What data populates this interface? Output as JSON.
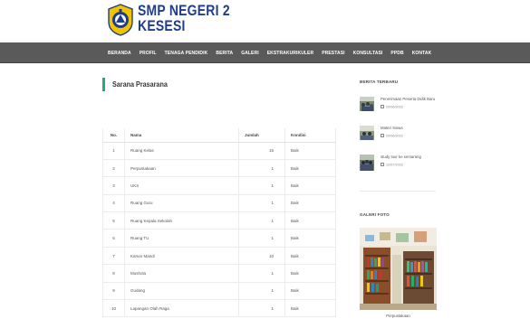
{
  "header": {
    "school_line1": "SMP NEGERI 2",
    "school_line2": "KESESI",
    "logo_icon": "school-emblem-icon"
  },
  "nav": {
    "items": [
      "BERANDA",
      "PROFIL",
      "TENAGA PENDIDIK",
      "BERITA",
      "GALERI",
      "EKSTRAKURIKULER",
      "PRESTASI",
      "KONSULTASI",
      "PPDB",
      "KONTAK"
    ]
  },
  "main": {
    "title": "Sarana Prasarana",
    "table": {
      "headers": [
        "No.",
        "Nama",
        "Jumlah",
        "Kondisi"
      ],
      "rows": [
        [
          "1",
          "Ruang Kelas",
          "15",
          "Baik"
        ],
        [
          "2",
          "Perpustakaan",
          "1",
          "Baik"
        ],
        [
          "3",
          "UKS",
          "1",
          "Baik"
        ],
        [
          "4",
          "Ruang Guru",
          "1",
          "Baik"
        ],
        [
          "5",
          "Ruang Kepala Sekolah",
          "1",
          "Baik"
        ],
        [
          "6",
          "Ruang TU",
          "1",
          "Baik"
        ],
        [
          "7",
          "Kamar Mandi",
          "10",
          "Baik"
        ],
        [
          "8",
          "Mushola",
          "1",
          "Baik"
        ],
        [
          "9",
          "Gudang",
          "1",
          "Baik"
        ],
        [
          "10",
          "Lapangan Olah Raga",
          "1",
          "Baik"
        ]
      ]
    }
  },
  "sidebar": {
    "news_title": "BERITA TERBARU",
    "news": [
      {
        "title": "Penerimaan Peserta Didik Baru",
        "date": "20/06/2022"
      },
      {
        "title": "Materi Siswa",
        "date": "20/06/2021"
      },
      {
        "title": "study tour ke semarang",
        "date": "12/07/2022"
      }
    ],
    "gallery_title": "GALERI FOTO",
    "gallery_caption": "Perpustakaan"
  },
  "colors": {
    "nav_bg": "#5a5a5a",
    "accent": "#2aa876",
    "brand": "#1f3d8a"
  }
}
